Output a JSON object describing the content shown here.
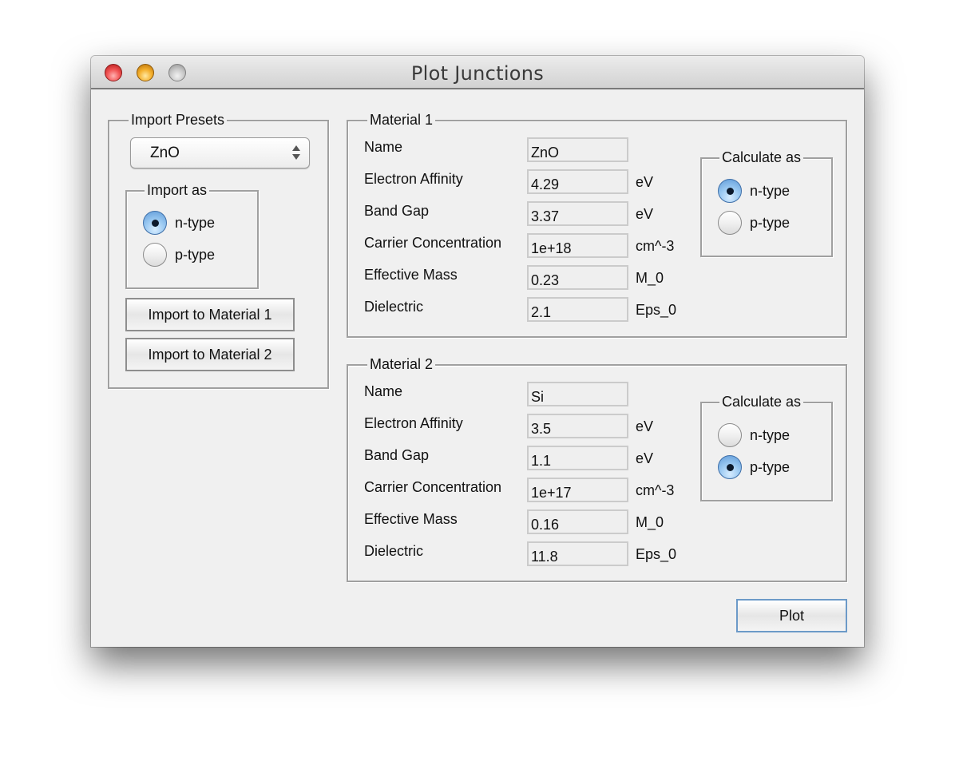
{
  "window": {
    "title": "Plot Junctions",
    "controls": [
      "close",
      "minimize",
      "zoom"
    ]
  },
  "presets": {
    "group_label": "Import Presets",
    "selected_preset": "ZnO",
    "import_as": {
      "group_label": "Import as",
      "options": [
        "n-type",
        "p-type"
      ],
      "selected": "n-type"
    },
    "import_to_material1_label": "Import to Material 1",
    "import_to_material2_label": "Import to Material 2"
  },
  "materials": [
    {
      "group_label": "Material 1",
      "fields": [
        {
          "label": "Name",
          "value": "ZnO",
          "unit": ""
        },
        {
          "label": "Electron Affinity",
          "value": "4.29",
          "unit": "eV"
        },
        {
          "label": "Band Gap",
          "value": "3.37",
          "unit": "eV"
        },
        {
          "label": "Carrier Concentration",
          "value": "1e+18",
          "unit": "cm^-3"
        },
        {
          "label": "Effective Mass",
          "value": "0.23",
          "unit": "M_0"
        },
        {
          "label": "Dielectric",
          "value": "2.1",
          "unit": "Eps_0"
        }
      ],
      "calculate_as": {
        "group_label": "Calculate as",
        "options": [
          "n-type",
          "p-type"
        ],
        "selected": "n-type"
      }
    },
    {
      "group_label": "Material 2",
      "fields": [
        {
          "label": "Name",
          "value": "Si",
          "unit": ""
        },
        {
          "label": "Electron Affinity",
          "value": "3.5",
          "unit": "eV"
        },
        {
          "label": "Band Gap",
          "value": "1.1",
          "unit": "eV"
        },
        {
          "label": "Carrier Concentration",
          "value": "1e+17",
          "unit": "cm^-3"
        },
        {
          "label": "Effective Mass",
          "value": "0.16",
          "unit": "M_0"
        },
        {
          "label": "Dielectric",
          "value": "11.8",
          "unit": "Eps_0"
        }
      ],
      "calculate_as": {
        "group_label": "Calculate as",
        "options": [
          "n-type",
          "p-type"
        ],
        "selected": "p-type"
      }
    }
  ],
  "plot_button_label": "Plot"
}
